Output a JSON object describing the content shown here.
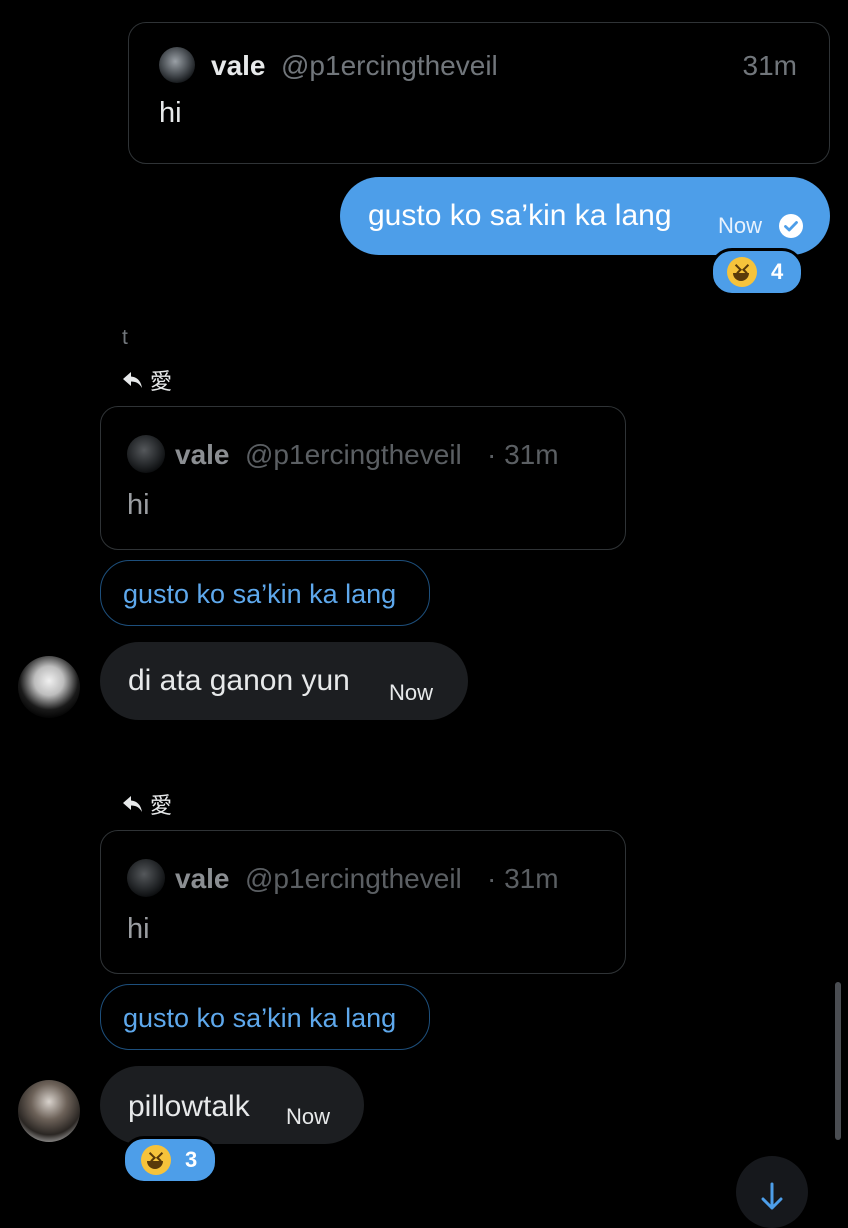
{
  "top_quote": {
    "name": "vale",
    "handle": "@p1ercingtheveil",
    "time": "31m",
    "text": "hi"
  },
  "sent_message": {
    "text": "gusto ko sa’kin ka lang",
    "time": "Now",
    "reaction_count": "4"
  },
  "thread_label": "t",
  "reply_1": {
    "reply_to_label": "愛",
    "quote": {
      "name": "vale",
      "handle": "@p1ercingtheveil",
      "time_sep": "· 31m",
      "text": "hi"
    },
    "replied_text": "gusto ko sa’kin ka lang",
    "message": "di ata ganon yun",
    "time": "Now"
  },
  "reply_2": {
    "reply_to_label": "愛",
    "quote": {
      "name": "vale",
      "handle": "@p1ercingtheveil",
      "time_sep": "· 31m",
      "text": "hi"
    },
    "replied_text": "gusto ko sa’kin ka lang",
    "message": "pillowtalk",
    "time": "Now",
    "reaction_count": "3"
  },
  "colors": {
    "accent": "#4d9ee9",
    "bubble_in": "#1c1e21",
    "background": "#000000"
  },
  "icons": {
    "reply": "reply-arrow-icon",
    "verified": "check-circle-icon",
    "reaction": "grinning-squinting-face-emoji",
    "scroll_down": "arrow-down-icon"
  }
}
